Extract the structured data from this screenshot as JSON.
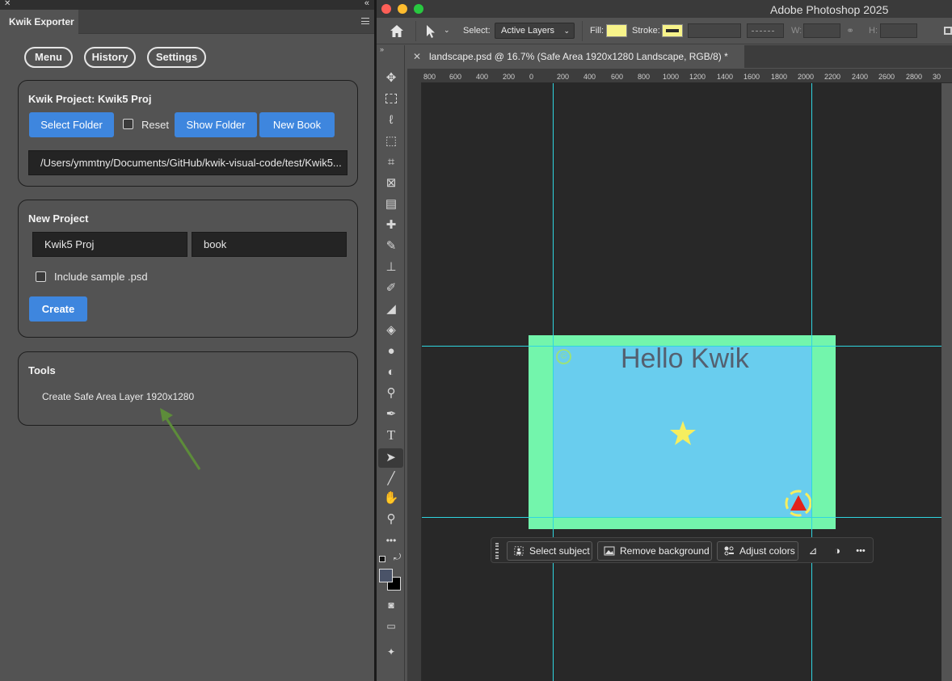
{
  "panel": {
    "tab_label": "Kwik Exporter",
    "nav": {
      "menu": "Menu",
      "history": "History",
      "settings": "Settings"
    },
    "project": {
      "title": "Kwik Project: Kwik5 Proj",
      "select_folder": "Select Folder",
      "reset_label": "Reset",
      "show_folder": "Show Folder",
      "new_book": "New Book",
      "path": "/Users/ymmtny/Documents/GitHub/kwik-visual-code/test/Kwik5..."
    },
    "new_project": {
      "title": "New Project",
      "project_name_value": "Kwik5 Proj",
      "book_name_value": "book",
      "include_sample_label": "Include sample .psd",
      "create": "Create"
    },
    "tools": {
      "title": "Tools",
      "safe_area_item": "Create Safe Area Layer 1920x1280"
    }
  },
  "photoshop": {
    "app_title": "Adobe Photoshop 2025",
    "options": {
      "select_label": "Select:",
      "select_value": "Active Layers",
      "fill_label": "Fill:",
      "stroke_label": "Stroke:",
      "w_label": "W:",
      "h_label": "H:",
      "fill_color": "#f7f38a"
    },
    "document_tab": "landscape.psd @ 16.7% (Safe Area 1920x1280 Landscape, RGB/8) *",
    "ruler_labels": [
      "800",
      "600",
      "400",
      "200",
      "0",
      "200",
      "400",
      "600",
      "800",
      "1000",
      "1200",
      "1400",
      "1600",
      "1800",
      "2000",
      "2200",
      "2400",
      "2600",
      "2800",
      "30"
    ],
    "canvas": {
      "headline": "Hello Kwik",
      "safe_area_color": "#73f5ac",
      "content_color": "#69cdee"
    },
    "contextual_bar": {
      "select_subject": "Select subject",
      "remove_background": "Remove background",
      "adjust_colors": "Adjust colors"
    }
  }
}
